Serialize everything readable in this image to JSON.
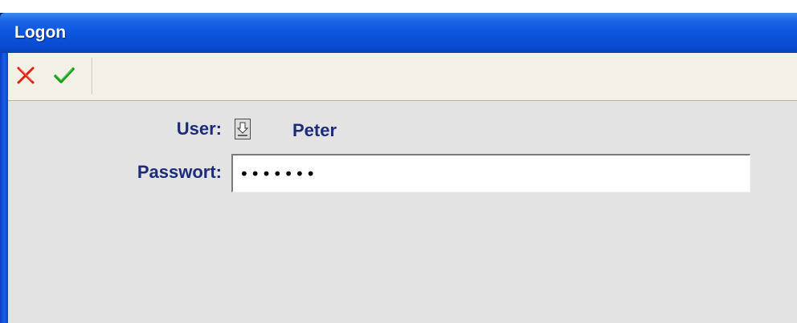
{
  "window": {
    "title": "Logon"
  },
  "toolbar": {
    "cancel_icon": "cancel-x-icon",
    "ok_icon": "checkmark-icon",
    "cancel_color": "#e02010",
    "ok_color": "#18a018"
  },
  "form": {
    "user_label": "User:",
    "user_value": "Peter",
    "user_select_icon": "down-arrow-icon",
    "password_label": "Passwort:",
    "password_value": "•••••••"
  },
  "colors": {
    "title_bar": "#0a54dc",
    "label_text": "#1c2c78",
    "content_bg": "#e3e3e3",
    "toolbar_bg": "#f3f1e7"
  }
}
